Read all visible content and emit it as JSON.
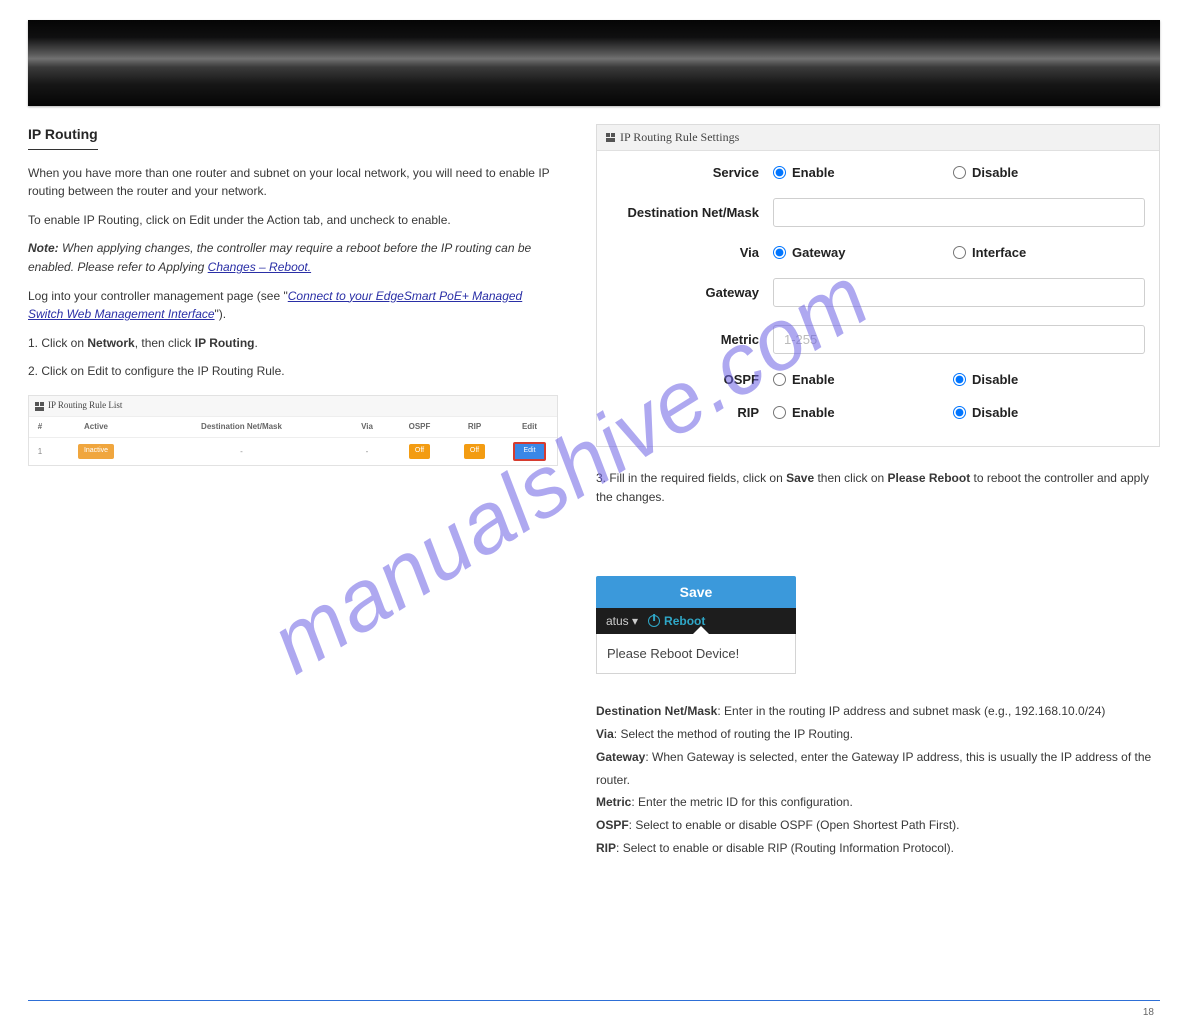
{
  "section_title": "IP Routing",
  "watermark": "manualshive.com",
  "intro1": "When you have more than one router and subnet on your local network, you will need to enable IP routing between the router and your network.",
  "intro2": "To enable IP Routing, click on Edit under the Action tab, and uncheck to enable.",
  "note_label": "Note:",
  "note_body": " When applying changes, the controller may require a reboot before the IP routing can be enabled. Please refer to Applying ",
  "note_link_text": "Changes – Reboot.",
  "path": "Log into your controller management page (see \"",
  "path_link": "Connect to your EdgeSmart PoE+ Managed Switch Web Management Interface",
  "path_after": "\").",
  "steps_prefix": "1. Click on ",
  "step_network": "Network",
  "step_then": ", then click ",
  "step_iprouting": "IP Routing",
  "step_period": ".",
  "step2": "2. Click on Edit to configure the IP Routing Rule.",
  "rule_list": {
    "title": "IP Routing Rule List",
    "headers": {
      "num": "#",
      "active": "Active",
      "dest": "Destination Net/Mask",
      "via": "Via",
      "ospf": "OSPF",
      "rip": "RIP",
      "edit": "Edit"
    },
    "row": {
      "num": "1",
      "active": "Inactive",
      "dest": "-",
      "via": "-",
      "ospf": "Off",
      "rip": "Off",
      "edit": "Edit"
    }
  },
  "settings": {
    "title": "IP Routing Rule Settings",
    "labels": {
      "service": "Service",
      "dest": "Destination Net/Mask",
      "via": "Via",
      "gateway": "Gateway",
      "metric": "Metric",
      "ospf": "OSPF",
      "rip": "RIP"
    },
    "options": {
      "enable": "Enable",
      "disable": "Disable",
      "gateway": "Gateway",
      "interface": "Interface"
    },
    "metric_placeholder": "1-255"
  },
  "step3_a": "3. Fill in the required fields, click on ",
  "step3_save": "Save",
  "step3_b": " then click on ",
  "step3_reboot": "Please Reboot",
  "step3_c": " to reboot the controller and apply the changes.",
  "field_help": {
    "dest": "Enter in the routing IP address and subnet mask (e.g., 192.168.10.0/24)",
    "via": "Select the method of routing the IP Routing.",
    "gateway": "When Gateway is selected, enter the Gateway IP address, this is usually the IP address of the router.",
    "metric": "Enter the metric ID for this configuration.",
    "ospf": "Select to enable or disable OSPF (Open Shortest Path First).",
    "rip": "Select to enable or disable RIP (Routing Information Protocol)."
  },
  "save_btn": "Save",
  "nav_status": "atus",
  "nav_reboot": "Reboot",
  "notif": "Please Reboot Device!",
  "page_number": "18"
}
